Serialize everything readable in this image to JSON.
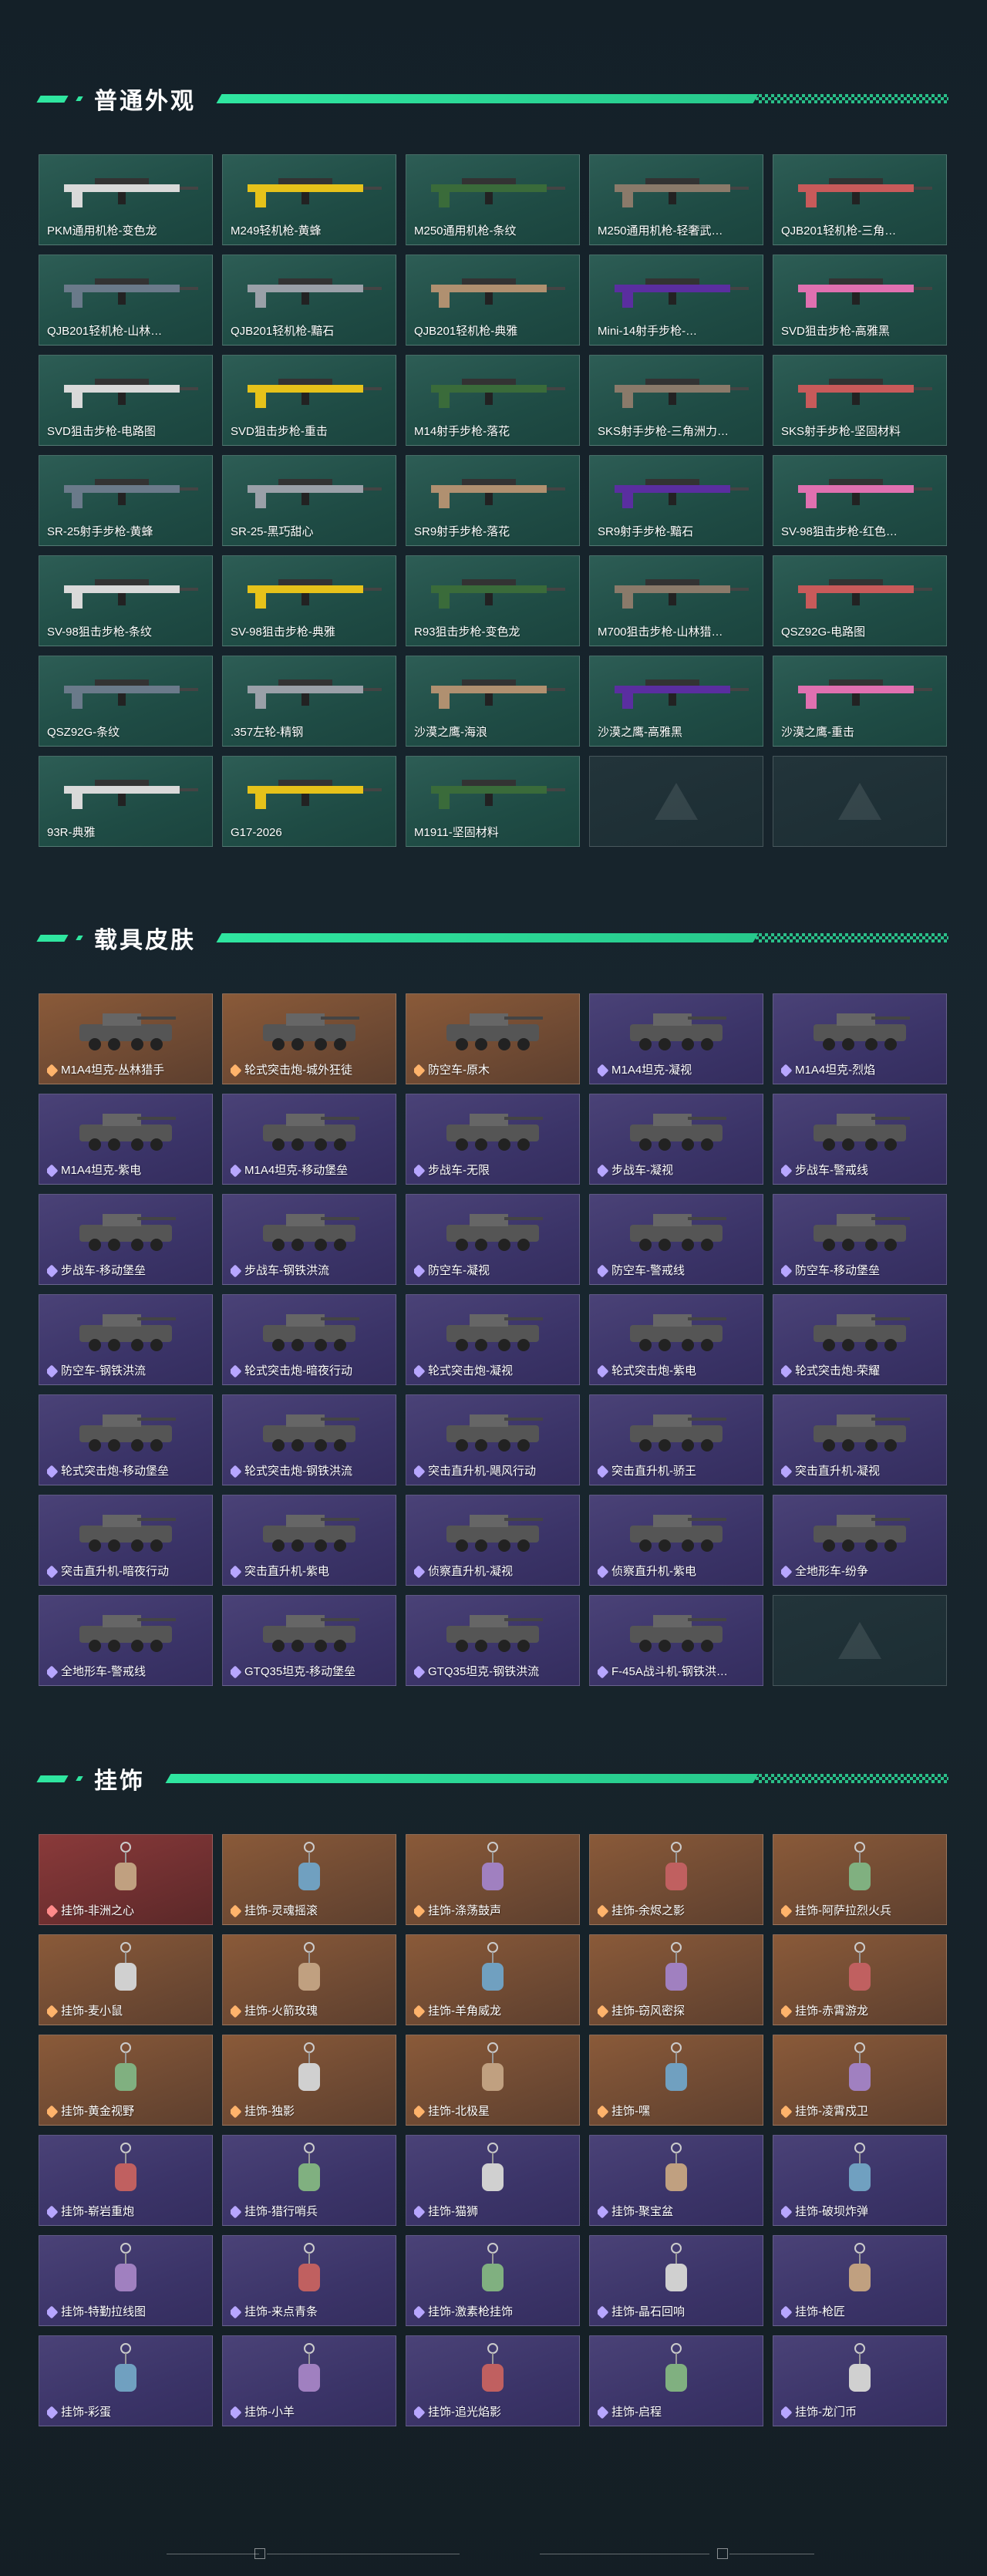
{
  "sections": [
    {
      "title": "普通外观",
      "style": "green",
      "items": [
        "PKM通用机枪-变色龙",
        "M249轻机枪-黄蜂",
        "M250通用机枪-条纹",
        "M250通用机枪-轻奢武…",
        "QJB201轻机枪-三角…",
        "QJB201轻机枪-山林…",
        "QJB201轻机枪-黯石",
        "QJB201轻机枪-典雅",
        "Mini-14射手步枪-…",
        "SVD狙击步枪-高雅黑",
        "SVD狙击步枪-电路图",
        "SVD狙击步枪-重击",
        "M14射手步枪-落花",
        "SKS射手步枪-三角洲力…",
        "SKS射手步枪-坚固材料",
        "SR-25射手步枪-黄蜂",
        "SR-25-黑巧甜心",
        "SR9射手步枪-落花",
        "SR9射手步枪-黯石",
        "SV-98狙击步枪-红色…",
        "SV-98狙击步枪-条纹",
        "SV-98狙击步枪-典雅",
        "R93狙击步枪-变色龙",
        "M700狙击步枪-山林猎…",
        "QSZ92G-电路图",
        "QSZ92G-条纹",
        ".357左轮-精钢",
        "沙漠之鹰-海浪",
        "沙漠之鹰-高雅黑",
        "沙漠之鹰-重击",
        "93R-典雅",
        "G17-2026",
        "M1911-坚固材料",
        "",
        ""
      ]
    },
    {
      "title": "载具皮肤",
      "style": "purple",
      "items": [
        "M1A4坦克-丛林猎手",
        "轮式突击炮-城外狂徒",
        "防空车-原木",
        "M1A4坦克-凝视",
        "M1A4坦克-烈焰",
        "M1A4坦克-紫电",
        "M1A4坦克-移动堡垒",
        "步战车-无限",
        "步战车-凝视",
        "步战车-警戒线",
        "步战车-移动堡垒",
        "步战车-钢铁洪流",
        "防空车-凝视",
        "防空车-警戒线",
        "防空车-移动堡垒",
        "防空车-钢铁洪流",
        "轮式突击炮-暗夜行动",
        "轮式突击炮-凝视",
        "轮式突击炮-紫电",
        "轮式突击炮-荣耀",
        "轮式突击炮-移动堡垒",
        "轮式突击炮-钢铁洪流",
        "突击直升机-飓风行动",
        "突击直升机-骄王",
        "突击直升机-凝视",
        "突击直升机-暗夜行动",
        "突击直升机-紫电",
        "侦察直升机-凝视",
        "侦察直升机-紫电",
        "全地形车-纷争",
        "全地形车-警戒线",
        "GTQ35坦克-移动堡垒",
        "GTQ35坦克-钢铁洪流",
        "F-45A战斗机-钢铁洪…",
        ""
      ],
      "orange_indices": [
        0,
        1,
        2
      ]
    },
    {
      "title": "挂饰",
      "style": "purple",
      "items": [
        "挂饰-非洲之心",
        "挂饰-灵魂摇滚",
        "挂饰-涤荡鼓声",
        "挂饰-余烬之影",
        "挂饰-阿萨拉烈火兵",
        "挂饰-麦小鼠",
        "挂饰-火箭玫瑰",
        "挂饰-羊角威龙",
        "挂饰-窃风密探",
        "挂饰-赤霄游龙",
        "挂饰-黄金视野",
        "挂饰-独影",
        "挂饰-北极星",
        "挂饰-嘿",
        "挂饰-凌霄戍卫",
        "挂饰-崭岩重炮",
        "挂饰-猎行哨兵",
        "挂饰-猫狮",
        "挂饰-聚宝盆",
        "挂饰-破坝炸弹",
        "挂饰-特勤拉线图",
        "挂饰-来点青条",
        "挂饰-激素枪挂饰",
        "挂饰-晶石回响",
        "挂饰-枪匠",
        "挂饰-彩蛋",
        "挂饰-小羊",
        "挂饰-追光焰影",
        "挂饰-启程",
        "挂饰-龙门币"
      ],
      "red_indices": [
        0
      ],
      "orange_indices": [
        1,
        2,
        3,
        4,
        5,
        6,
        7,
        8,
        9,
        10,
        11,
        12,
        13,
        14
      ]
    }
  ],
  "empty_icon": "delta-logo-icon"
}
